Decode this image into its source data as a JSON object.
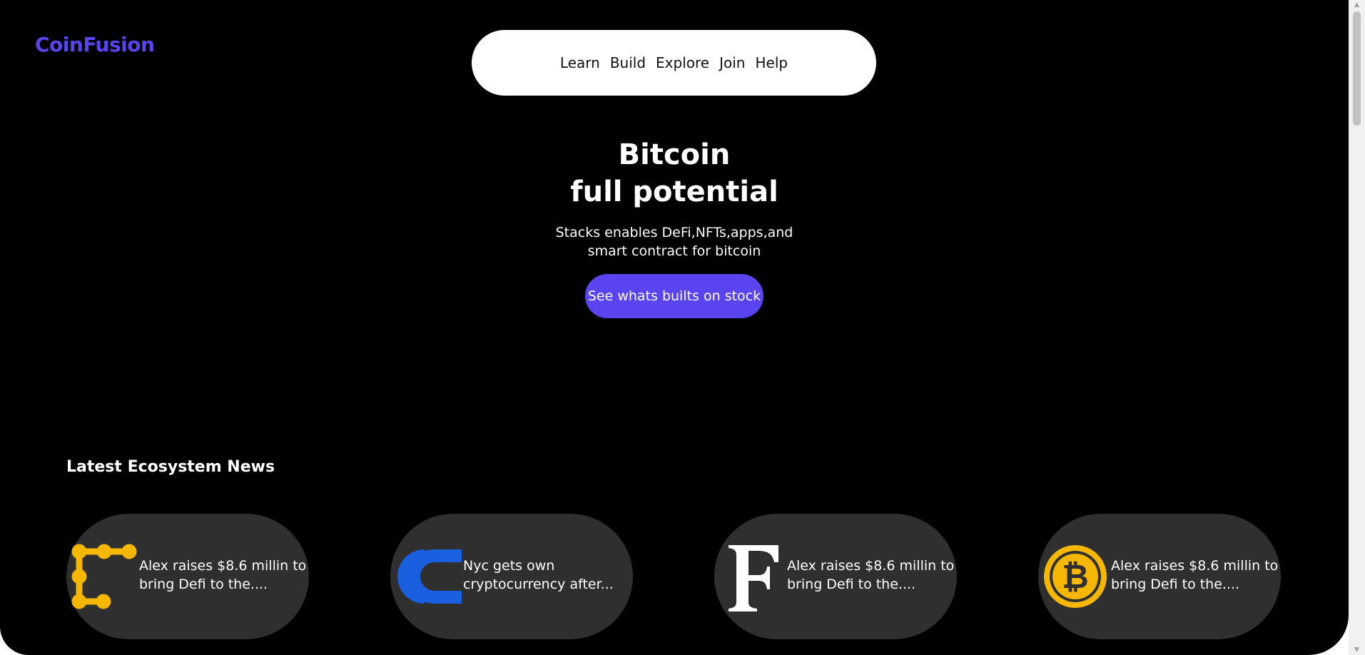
{
  "header": {
    "logo": "CoinFusion",
    "nav": [
      "Learn",
      "Build",
      "Explore",
      "Join",
      "Help"
    ]
  },
  "hero": {
    "title_line1": "Bitcoin",
    "title_line2": "full potential",
    "subtitle_line1": "Stacks enables DeFi,NFTs,apps,and",
    "subtitle_line2": "smart contract for bitcoin",
    "cta_label": "See whats builts on stock"
  },
  "news": {
    "heading": "Latest Ecosystem News",
    "cards": [
      {
        "icon": "alex-chain-logo-icon",
        "line1": "Alex raises $8.6 millin to",
        "line2": "bring Defi to the...."
      },
      {
        "icon": "nyc-coin-logo-icon",
        "line1": "Nyc gets own",
        "line2": "cryptocurrency after..."
      },
      {
        "icon": "forbes-f-logo-icon",
        "line1": "Alex raises $8.6 millin to",
        "line2": "bring Defi to the...."
      },
      {
        "icon": "bitcoin-logo-icon",
        "line1": "Alex raises $8.6 millin to",
        "line2": "bring Defi to the...."
      }
    ]
  },
  "colors": {
    "background": "#000000",
    "accent": "#5a44f0",
    "card": "#2f2f2f",
    "coin_yellow": "#f5b700",
    "nyc_blue": "#1a5fe0"
  }
}
